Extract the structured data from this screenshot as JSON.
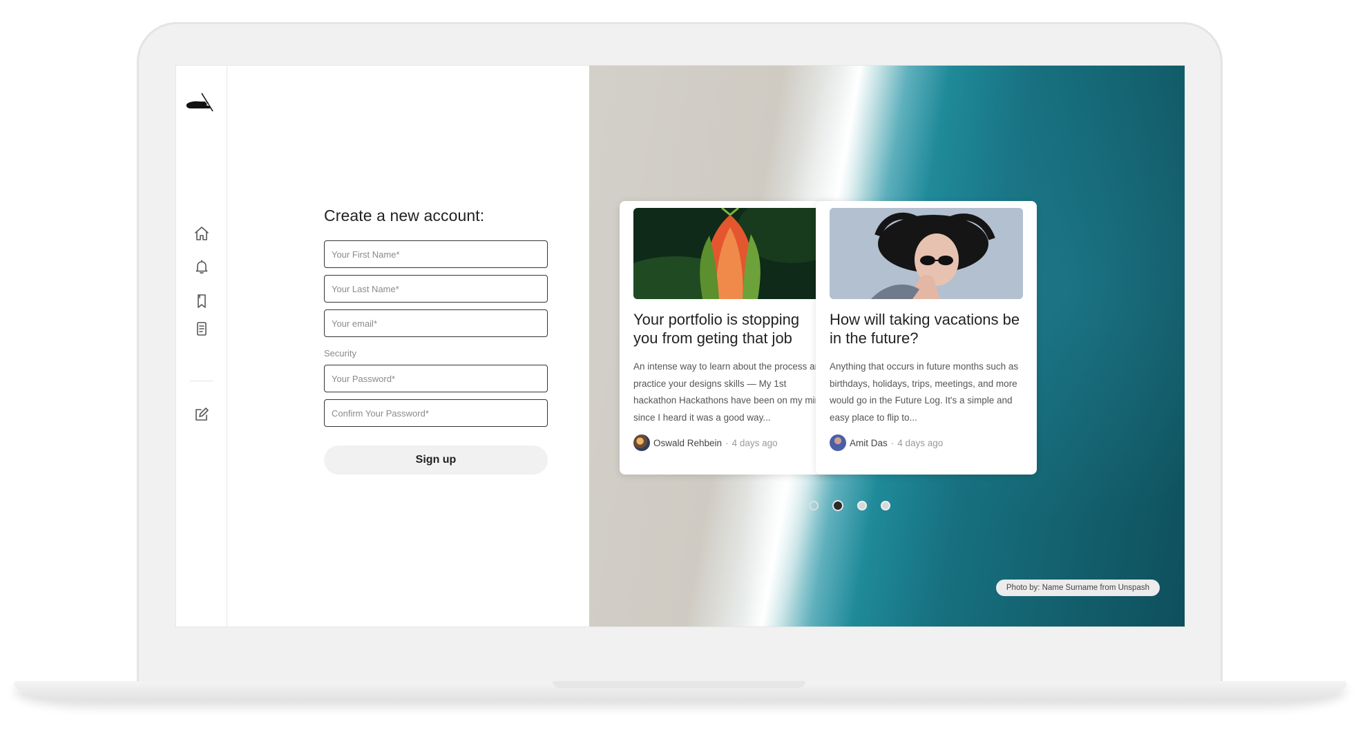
{
  "form": {
    "title": "Create a new account:",
    "first_name_placeholder": "Your First Name*",
    "last_name_placeholder": "Your Last Name*",
    "email_placeholder": "Your email*",
    "security_label": "Security",
    "password_placeholder": "Your Password*",
    "confirm_password_placeholder": "Confirm Your Password*",
    "signup_label": "Sign up"
  },
  "sidebar": {
    "icons": [
      "logo",
      "home-icon",
      "bell-icon",
      "bookmark-icon",
      "document-icon",
      "edit-icon"
    ]
  },
  "cards": [
    {
      "title": "Your portfolio is stopping you from geting that job",
      "excerpt": "An intense way to learn about the process and practice your designs skills — My 1st hackathon Hackathons have been on my mind since I heard it was a good way...",
      "author": "Oswald Rehbein",
      "time": "4 days ago"
    },
    {
      "title": "How will taking vacations be in the future?",
      "excerpt": "Anything that occurs in future months such as birthdays, holidays, trips, meetings, and more would go in the Future Log. It's a simple and easy place to flip to...",
      "author": "Amit Das",
      "time": "4 days ago"
    }
  ],
  "carousel": {
    "count": 4,
    "active_index": 1
  },
  "credit": "Photo by: Name Surname from Unspash"
}
